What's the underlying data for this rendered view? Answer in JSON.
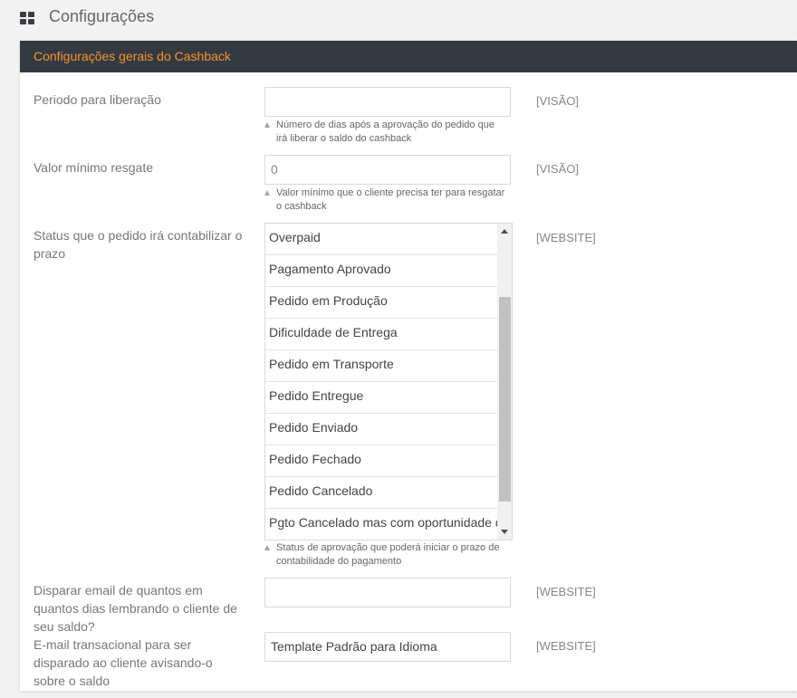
{
  "page": {
    "title": "Configurações"
  },
  "panel": {
    "heading": "Configurações gerais do Cashback"
  },
  "fields": {
    "release_period": {
      "label": "Periodo para liberação",
      "value": "",
      "scope": "[VISÃO]",
      "hint": "Número de dias após a aprovação do pedido que irá liberar o saldo do cashback"
    },
    "min_redeem": {
      "label": "Valor mínimo resgate",
      "value": "0",
      "scope": "[VISÃO]",
      "hint": "Valor mínimo que o cliente precisa ter para resgatar o cashback"
    },
    "order_status": {
      "label": "Status que o pedido irá contabilizar o prazo",
      "scope": "[WEBSITE]",
      "options": [
        "Overpaid",
        "Pagamento Aprovado",
        "Pedido em Produção",
        "Dificuldade de Entrega",
        "Pedido em Transporte",
        "Pedido Entregue",
        "Pedido Enviado",
        "Pedido Fechado",
        "Pedido Cancelado",
        "Pgto Cancelado mas com oportunidade de"
      ],
      "hint": "Status de aprovação que poderá iniciar o prazo de contabilidade do pagamento"
    },
    "reminder_days": {
      "label": "Disparar email de quantos em quantos dias lembrando o cliente de seu saldo?",
      "value": "",
      "scope": "[WEBSITE]"
    },
    "email_template": {
      "label": "E-mail transacional para ser disparado ao cliente avisando-o sobre o saldo",
      "value": "Template Padrão para Idioma",
      "scope": "[WEBSITE]"
    }
  }
}
